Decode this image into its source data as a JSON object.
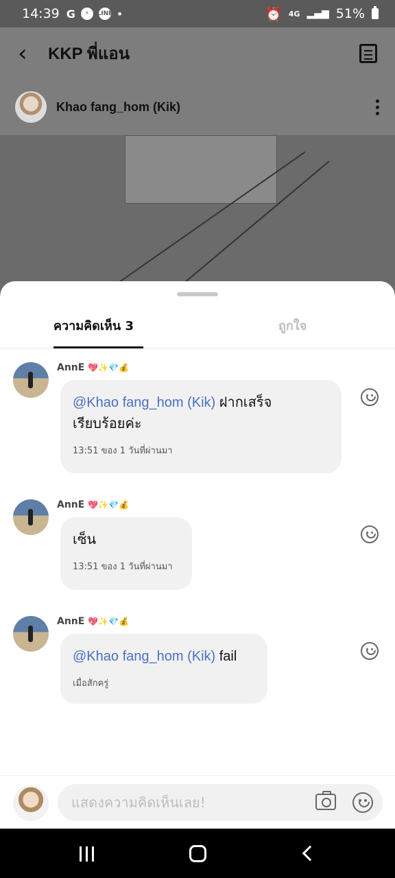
{
  "status_bar": {
    "time": "14:39",
    "left_icons": [
      "G",
      "messenger-icon",
      "LINE",
      "•"
    ],
    "network": "4G",
    "battery": "51%"
  },
  "header": {
    "title": "KKP พี่แอน"
  },
  "post": {
    "author": "Khao fang_hom (Kik)"
  },
  "sheet": {
    "tabs": [
      {
        "label": "ความคิดเห็น 3",
        "active": true
      },
      {
        "label": "ถูกใจ",
        "active": false
      }
    ],
    "comments": [
      {
        "user": "AnnE",
        "emojis": "💖✨💎💰",
        "mention": "@Khao fang_hom (Kik)",
        "text": " ฝากเสร็จ",
        "text2": "เรียบร้อยค่ะ",
        "time": "13:51 ของ 1 วันที่ผ่านมา"
      },
      {
        "user": "AnnE",
        "emojis": "💖✨💎💰",
        "text": "เซ็น",
        "time": "13:51 ของ 1 วันที่ผ่านมา"
      },
      {
        "user": "AnnE",
        "emojis": "💖✨💎💰",
        "mention": "@Khao fang_hom (Kik)",
        "text": " fail",
        "time": "เมื่อสักครู่"
      }
    ]
  },
  "composer": {
    "placeholder": "แสดงความคิดเห็นเลย!"
  },
  "colors": {
    "mention": "#4a6fc4",
    "bubble": "#f1f1f1",
    "overlay": "#7d7d7d"
  }
}
